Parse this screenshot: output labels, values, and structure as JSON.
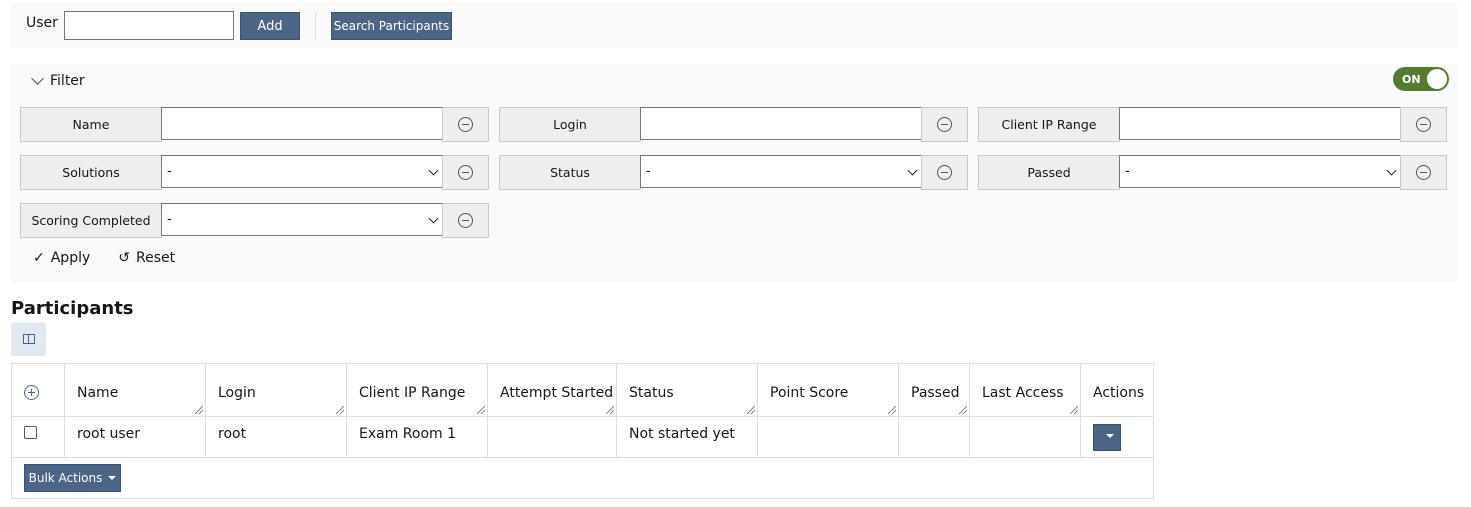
{
  "toolbar": {
    "user_label": "User",
    "user_value": "",
    "add_label": "Add",
    "search_label": "Search Participants"
  },
  "filter": {
    "title": "Filter",
    "toggle_label": "ON",
    "fields": [
      {
        "label": "Name",
        "type": "input",
        "value": ""
      },
      {
        "label": "Login",
        "type": "input",
        "value": ""
      },
      {
        "label": "Client IP Range",
        "type": "input",
        "value": ""
      },
      {
        "label": "Solutions",
        "type": "select",
        "value": "-"
      },
      {
        "label": "Status",
        "type": "select",
        "value": "-"
      },
      {
        "label": "Passed",
        "type": "select",
        "value": "-"
      },
      {
        "label": "Scoring Completed",
        "type": "select",
        "value": "-"
      }
    ],
    "apply_label": "Apply",
    "reset_label": "Reset"
  },
  "participants": {
    "title": "Participants",
    "columns": [
      "Name",
      "Login",
      "Client IP Range",
      "Attempt Started",
      "Status",
      "Point Score",
      "Passed",
      "Last Access",
      "Actions"
    ],
    "rows": [
      [
        "root user",
        "root",
        "Exam Room 1",
        "",
        "Not started yet",
        "",
        "",
        ""
      ]
    ],
    "bulk_label": "Bulk Actions"
  },
  "colors": {
    "accent": "#4c6586",
    "toggle_on": "#557b2e",
    "panel_bg": "#f9f9f9"
  }
}
